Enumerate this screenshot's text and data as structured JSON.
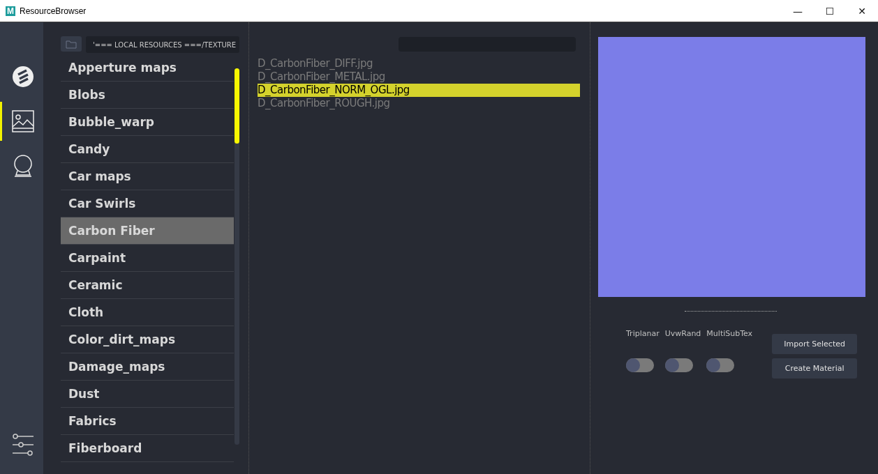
{
  "window": {
    "logo": "M",
    "title": "ResourceBrowser",
    "controls": [
      "—",
      "☐",
      "✕"
    ]
  },
  "rail": {
    "items": [
      {
        "kind": "logo",
        "selected": false
      },
      {
        "kind": "image",
        "selected": true
      },
      {
        "kind": "ball",
        "selected": false
      }
    ],
    "bottom_items": [
      {
        "kind": "settings",
        "selected": false
      }
    ]
  },
  "path": {
    "value": "'=== LOCAL RESOURCES ===/TEXTURE"
  },
  "categories": [
    {
      "label": "Apperture maps",
      "selected": false
    },
    {
      "label": "Blobs",
      "selected": false
    },
    {
      "label": "Bubble_warp",
      "selected": false
    },
    {
      "label": "Candy",
      "selected": false
    },
    {
      "label": "Car maps",
      "selected": false
    },
    {
      "label": "Car Swirls",
      "selected": false
    },
    {
      "label": "Carbon Fiber",
      "selected": true
    },
    {
      "label": "Carpaint",
      "selected": false
    },
    {
      "label": "Ceramic",
      "selected": false
    },
    {
      "label": "Cloth",
      "selected": false
    },
    {
      "label": "Color_dirt_maps",
      "selected": false
    },
    {
      "label": "Damage_maps",
      "selected": false
    },
    {
      "label": "Dust",
      "selected": false
    },
    {
      "label": "Fabrics",
      "selected": false
    },
    {
      "label": "Fiberboard",
      "selected": false
    }
  ],
  "files": [
    {
      "label": "D_CarbonFiber_DIFF.jpg",
      "selected": false
    },
    {
      "label": "D_CarbonFiber_METAL.jpg",
      "selected": false
    },
    {
      "label": "D_CarbonFiber_NORM_OGL.jpg",
      "selected": true
    },
    {
      "label": "D_CarbonFiber_ROUGH.jpg",
      "selected": false
    }
  ],
  "preview": {
    "color": "#7b7de8"
  },
  "toggles": [
    {
      "label": "Triplanar",
      "on": false
    },
    {
      "label": "UvwRand",
      "on": false
    },
    {
      "label": "MultiSubTex",
      "on": false
    }
  ],
  "buttons": [
    "Import Selected",
    "Create Material"
  ]
}
